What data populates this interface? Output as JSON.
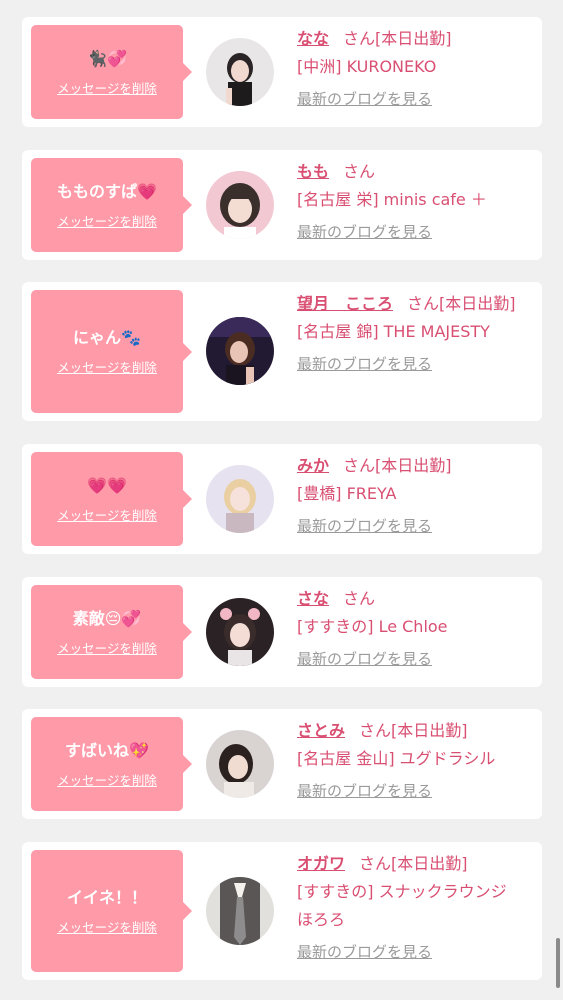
{
  "delete_label": "メッセージを削除",
  "blog_label": "最新のブログを見る",
  "san_label": "さん",
  "cards": [
    {
      "message": "🐈‍⬛💞",
      "name": "なな",
      "status": "[本日出勤]",
      "shop": "[中洲] KURONEKO"
    },
    {
      "message": "もものすぱ💗",
      "name": "もも",
      "status": "",
      "shop": "[名古屋 栄] minis cafe ＋"
    },
    {
      "message": "にゃん🐾",
      "name": "望月　こころ",
      "status": "[本日出勤]",
      "shop": "[名古屋 錦] THE MAJESTY"
    },
    {
      "message": "💗💗",
      "name": "みか",
      "status": "[本日出勤]",
      "shop": "[豊橋] FREYA"
    },
    {
      "message": "素敵😔💞",
      "name": "さな",
      "status": "",
      "shop": "[すすきの] Le Chloe"
    },
    {
      "message": "すばいね💖",
      "name": "さとみ",
      "status": "[本日出勤]",
      "shop": "[名古屋 金山] ユグドラシル"
    },
    {
      "message": "イイネ！！",
      "name": "オガワ",
      "status": "[本日出勤]",
      "shop": "[すすきの] スナックラウンジ　ほろろ"
    }
  ],
  "colors": {
    "bubble": "#ff9aa8",
    "accent": "#d94f72",
    "link_gray": "#9a9a9a",
    "background": "#f0f0f0"
  }
}
